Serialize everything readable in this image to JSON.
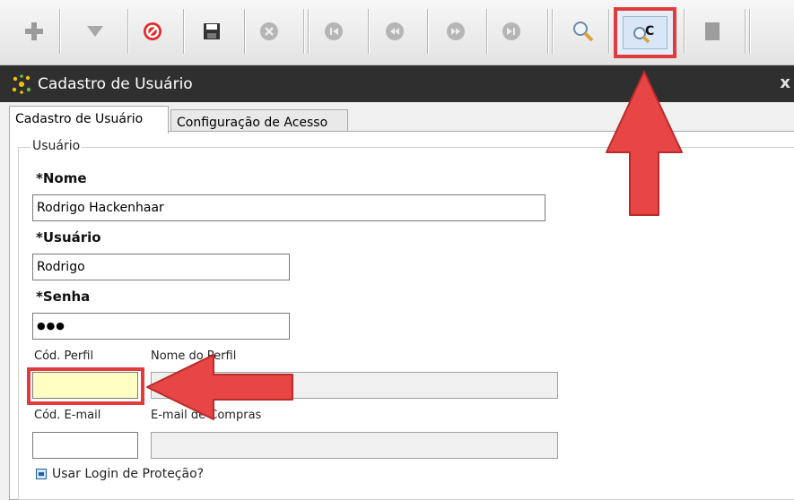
{
  "toolbar": {
    "buttons": [
      {
        "name": "add-icon"
      },
      {
        "name": "dropdown-icon"
      },
      {
        "name": "cancel-icon"
      },
      {
        "name": "save-icon"
      },
      {
        "name": "delete-icon"
      },
      {
        "name": "first-record-icon"
      },
      {
        "name": "previous-record-icon"
      },
      {
        "name": "next-record-icon"
      },
      {
        "name": "last-record-icon"
      },
      {
        "name": "search-icon"
      },
      {
        "name": "copy-search-icon"
      },
      {
        "name": "report-icon"
      }
    ],
    "highlighted_button_glyph": "C"
  },
  "window": {
    "title": "Cadastro de Usuário",
    "close": "x"
  },
  "tabs": [
    {
      "label": "Cadastro de Usuário",
      "active": true
    },
    {
      "label": "Configuração de Acesso",
      "active": false
    }
  ],
  "group": {
    "legend": "Usuário"
  },
  "form": {
    "nome_label": "*Nome",
    "nome_value": "Rodrigo Hackenhaar",
    "usuario_label": "*Usuário",
    "usuario_value": "Rodrigo",
    "senha_label": "*Senha",
    "senha_value": "●●●",
    "cod_perfil_label": "Cód. Perfil",
    "cod_perfil_value": "",
    "nome_perfil_label": "Nome do Perfil",
    "nome_perfil_value": "",
    "cod_email_label": "Cód. E-mail",
    "cod_email_value": "",
    "email_compras_label": "E-mail de Compras",
    "email_compras_value": "",
    "checkbox_label": "Usar Login de Proteção?"
  },
  "colors": {
    "highlight": "#e23b3b",
    "titlebar": "#2f2f2f",
    "required_field_bg": "#ffffc4"
  }
}
